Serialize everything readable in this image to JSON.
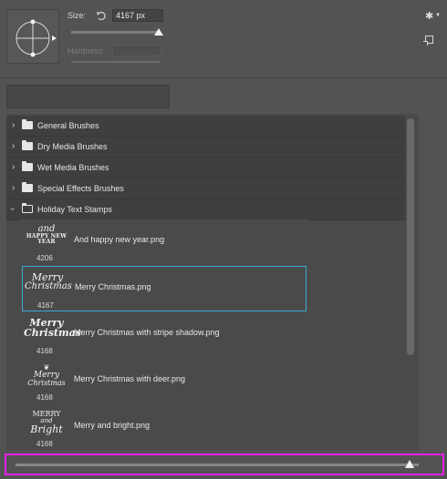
{
  "brush_settings": {
    "size_label": "Size:",
    "size_value": "4167 px",
    "hardness_label": "Hardness:",
    "size_slider_level": 0.94
  },
  "icons": {
    "reset": "reset-icon",
    "gear": "gear-icon",
    "new_preset": "new-preset-icon"
  },
  "folders": [
    {
      "label": "General Brushes",
      "expanded": false
    },
    {
      "label": "Dry Media Brushes",
      "expanded": false
    },
    {
      "label": "Wet Media Brushes",
      "expanded": false
    },
    {
      "label": "Special Effects Brushes",
      "expanded": false
    },
    {
      "label": "Holiday Text Stamps",
      "expanded": true
    }
  ],
  "brushes": [
    {
      "name": "And happy new year.png",
      "size": "4206",
      "selected": false
    },
    {
      "name": "Merry Christmas.png",
      "size": "4167",
      "selected": true
    },
    {
      "name": "Merry Christmas with stripe shadow.png",
      "size": "4168",
      "selected": false
    },
    {
      "name": "Merry Christmas with deer.png",
      "size": "4168",
      "selected": false
    },
    {
      "name": "Merry and bright.png",
      "size": "4168",
      "selected": false
    }
  ],
  "thumbnails": {
    "t0a": "and",
    "t0b": "HAPPY NEW YEAR",
    "t1a": "Merry",
    "t1b": "Christmas",
    "t2a": "Merry",
    "t2b": "Christmas",
    "t3a": "Merry",
    "t3b": "Christmas",
    "t4a": "MERRY",
    "t4b": "and",
    "t4c": "Bright"
  },
  "preview_slider_level": 0.99,
  "colors": {
    "selection": "#3fa7d8",
    "highlight_box": "#e51fe5"
  }
}
